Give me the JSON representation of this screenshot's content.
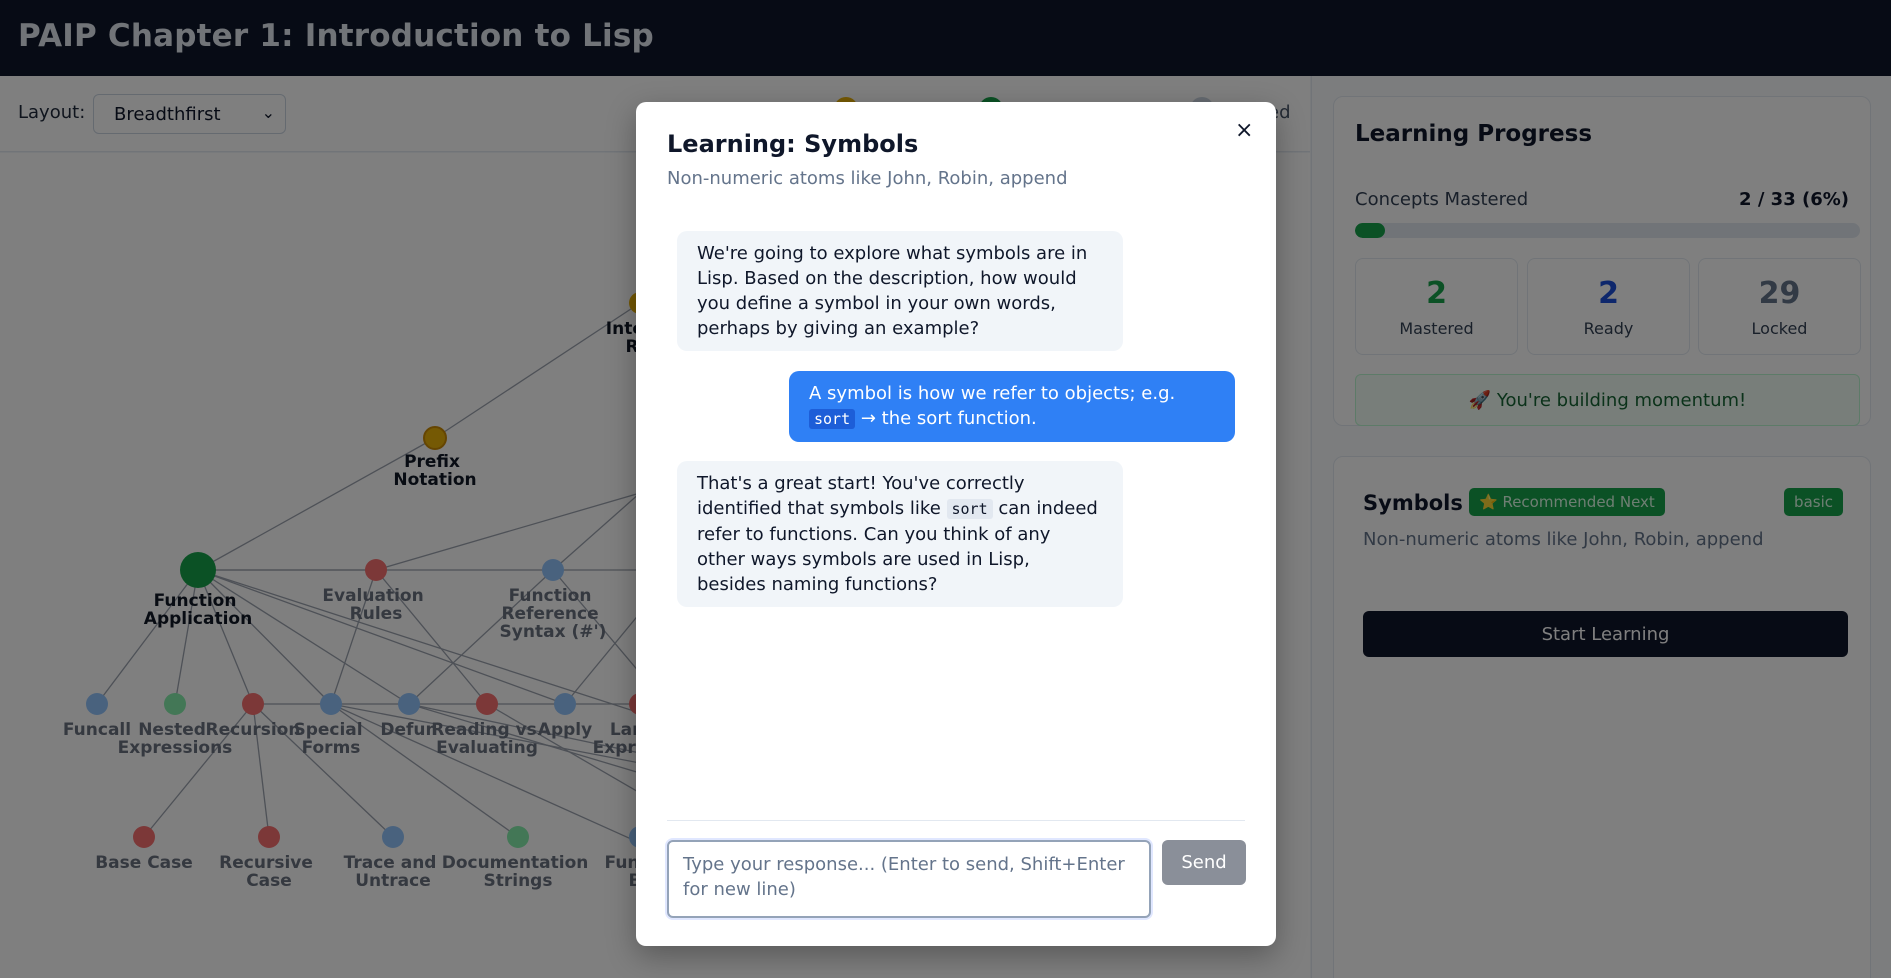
{
  "app": {
    "title": "PAIP Chapter 1: Introduction to Lisp"
  },
  "toolbar": {
    "layout_label": "Layout:",
    "layout_value": "Breadthfirst",
    "legend_partial": "ed"
  },
  "graph": {
    "nodes": [
      {
        "id": "interactive-repl",
        "lines": [
          "Inter",
          "R"
        ],
        "status": "ready"
      },
      {
        "id": "prefix-notation",
        "lines": [
          "Prefix",
          "Notation"
        ],
        "status": "ready"
      },
      {
        "id": "function-application",
        "lines": [
          "Function",
          "Application"
        ],
        "status": "mastered"
      },
      {
        "id": "evaluation-rules",
        "lines": [
          "Evaluation",
          "Rules"
        ],
        "status": "locked-red"
      },
      {
        "id": "function-reference-syntax",
        "lines": [
          "Function",
          "Reference",
          "Syntax (#')"
        ],
        "status": "locked-blue"
      },
      {
        "id": "funcall",
        "lines": [
          "Funcall"
        ],
        "status": "locked-blue"
      },
      {
        "id": "nested-expressions",
        "lines": [
          "Nested",
          "Expressions"
        ],
        "status": "locked-green"
      },
      {
        "id": "recursion",
        "lines": [
          "Recursion"
        ],
        "status": "locked-red"
      },
      {
        "id": "special-forms",
        "lines": [
          "Special",
          "Forms"
        ],
        "status": "locked-blue"
      },
      {
        "id": "defun",
        "lines": [
          "Defun"
        ],
        "status": "locked-blue"
      },
      {
        "id": "reading-vs-evaluating",
        "lines": [
          "Reading vs",
          "Evaluating"
        ],
        "status": "locked-red"
      },
      {
        "id": "apply",
        "lines": [
          "Apply"
        ],
        "status": "locked-blue"
      },
      {
        "id": "lambda-expressions",
        "lines": [
          "Lan",
          "Expre"
        ],
        "status": "locked-red"
      },
      {
        "id": "base-case",
        "lines": [
          "Base Case"
        ],
        "status": "locked-red"
      },
      {
        "id": "recursive-case",
        "lines": [
          "Recursive",
          "Case"
        ],
        "status": "locked-red"
      },
      {
        "id": "trace-and-untrace",
        "lines": [
          "Trace and",
          "Untrace"
        ],
        "status": "locked-blue"
      },
      {
        "id": "documentation-strings",
        "lines": [
          "Documentation",
          "Strings"
        ],
        "status": "locked-green"
      },
      {
        "id": "function-b",
        "lines": [
          "Fun",
          "B"
        ],
        "status": "locked-blue"
      }
    ]
  },
  "colors": {
    "mastered": "#16a34a",
    "ready": "#eab308",
    "locked_red": "#f87171",
    "locked_blue": "#93c5fd",
    "locked_green": "#86efac",
    "user_bubble": "#2f80f5",
    "dark": "#0f172a"
  },
  "modal": {
    "title": "Learning: Symbols",
    "subtitle": "Non-numeric atoms like John, Robin, append",
    "close_icon": "×",
    "messages": [
      {
        "role": "ai",
        "text": "We're going to explore what symbols are in Lisp. Based on the description, how would you define a symbol in your own words, perhaps by giving an example?"
      },
      {
        "role": "user",
        "before": "A symbol is how we refer to objects; e.g.",
        "code": "sort",
        "after": "→ the sort function."
      },
      {
        "role": "ai",
        "before": "That's a great start! You've correctly identified that symbols like",
        "code": "sort",
        "after": "can indeed refer to functions. Can you think of any other ways symbols are used in Lisp, besides naming functions?"
      }
    ],
    "input_placeholder": "Type your response... (Enter to send, Shift+Enter for new line)",
    "send_label": "Send"
  },
  "progress": {
    "title": "Learning Progress",
    "concepts_label": "Concepts Mastered",
    "concepts_value": "2 / 33 (6%)",
    "fraction": 0.06,
    "stats": [
      {
        "value": "2",
        "label": "Mastered",
        "color": "#16a34a"
      },
      {
        "value": "2",
        "label": "Ready",
        "color": "#1d4ed8"
      },
      {
        "value": "29",
        "label": "Locked",
        "color": "#64748b"
      }
    ],
    "momentum": "🚀 You're building momentum!"
  },
  "concept": {
    "name": "Symbols",
    "badge": "⭐ Recommended Next",
    "level": "basic",
    "description": "Non-numeric atoms like John, Robin, append",
    "start_label": "Start Learning"
  }
}
